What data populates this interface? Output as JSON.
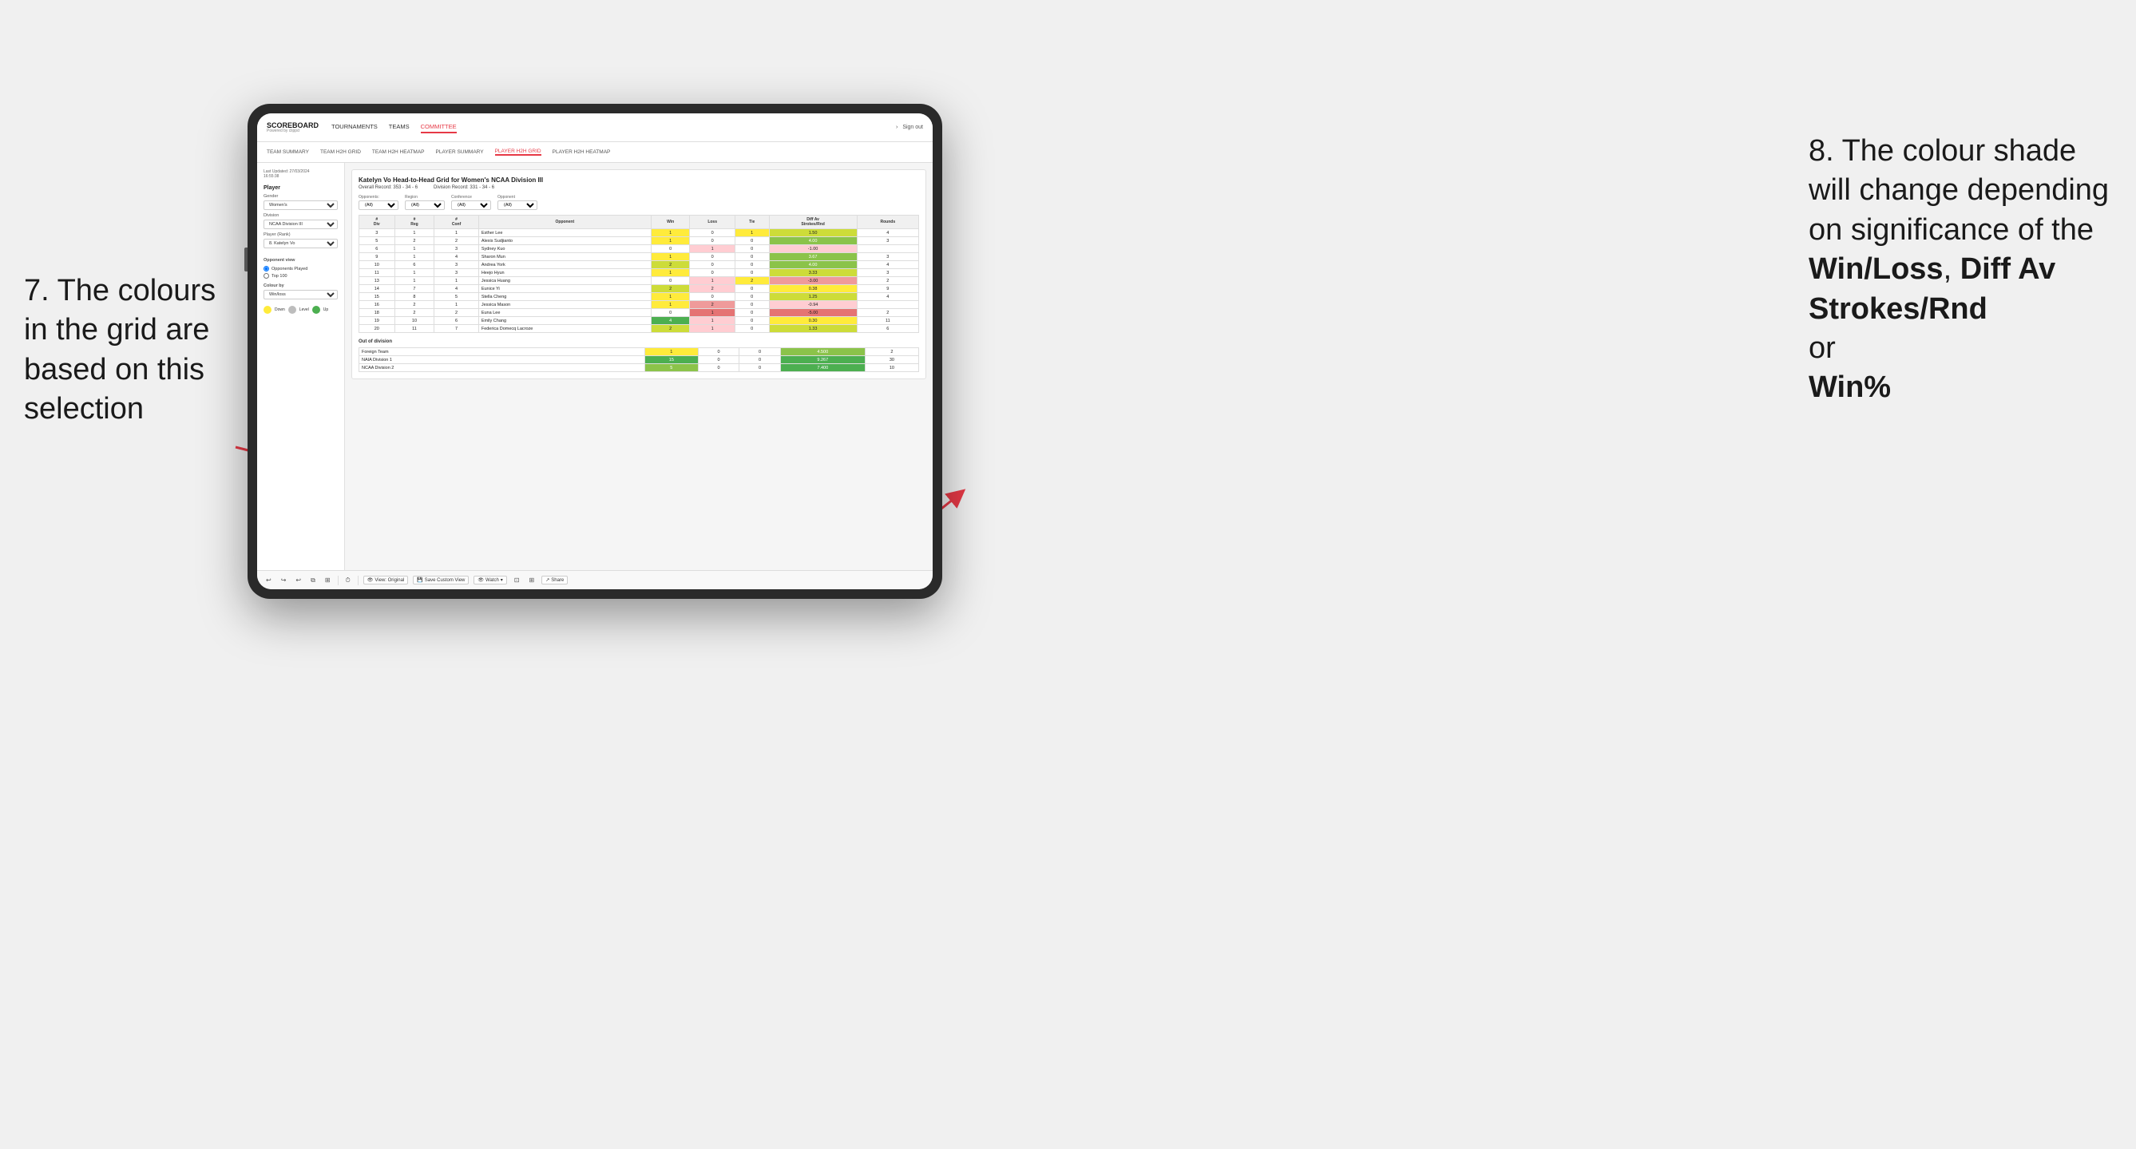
{
  "annotations": {
    "left_title": "7. The colours in the grid are based on this selection",
    "right_title": "8. The colour shade will change depending on significance of the",
    "right_bold1": "Win/Loss",
    "right_bold2": "Diff Av Strokes/Rnd",
    "right_bold3": "Win%"
  },
  "nav": {
    "logo": "SCOREBOARD",
    "logo_sub": "Powered by clippd",
    "items": [
      "TOURNAMENTS",
      "TEAMS",
      "COMMITTEE"
    ],
    "active": "COMMITTEE",
    "sign_out": "Sign out"
  },
  "sub_nav": {
    "items": [
      "TEAM SUMMARY",
      "TEAM H2H GRID",
      "TEAM H2H HEATMAP",
      "PLAYER SUMMARY",
      "PLAYER H2H GRID",
      "PLAYER H2H HEATMAP"
    ],
    "active": "PLAYER H2H GRID"
  },
  "left_panel": {
    "timestamp_label": "Last Updated: 27/03/2024",
    "timestamp_time": "16:55:38",
    "player_label": "Player",
    "gender_label": "Gender",
    "gender_value": "Women's",
    "division_label": "Division",
    "division_value": "NCAA Division III",
    "player_rank_label": "Player (Rank)",
    "player_rank_value": "8. Katelyn Vo",
    "opponent_view_label": "Opponent view",
    "opponent_played": "Opponents Played",
    "top_100": "Top 100",
    "colour_by_label": "Colour by",
    "colour_by_value": "Win/loss",
    "legend_down": "Down",
    "legend_level": "Level",
    "legend_up": "Up"
  },
  "grid": {
    "title": "Katelyn Vo Head-to-Head Grid for Women's NCAA Division III",
    "overall_label": "Overall Record:",
    "overall_value": "353 - 34 - 6",
    "division_label": "Division Record:",
    "division_value": "331 - 34 - 6",
    "filters": {
      "opponents_label": "Opponents:",
      "opponents_value": "(All)",
      "region_label": "Region",
      "region_value": "(All)",
      "conference_label": "Conference",
      "conference_value": "(All)",
      "opponent_label": "Opponent",
      "opponent_value": "(All)"
    },
    "table_headers": [
      "#\nDiv",
      "#\nReg",
      "#\nConf",
      "Opponent",
      "Win",
      "Loss",
      "Tie",
      "Diff Av\nStrokes/Rnd",
      "Rounds"
    ],
    "rows": [
      {
        "div": 3,
        "reg": 1,
        "conf": 1,
        "opponent": "Esther Lee",
        "win": 1,
        "loss": 0,
        "tie": 1,
        "diff": 1.5,
        "rounds": 4,
        "win_color": "yellow",
        "loss_color": "",
        "tie_color": "yellow",
        "diff_color": "green_light"
      },
      {
        "div": 5,
        "reg": 2,
        "conf": 2,
        "opponent": "Alexis Sudjianto",
        "win": 1,
        "loss": 0,
        "tie": 0,
        "diff": 4.0,
        "rounds": 3,
        "win_color": "yellow",
        "diff_color": "green_med"
      },
      {
        "div": 6,
        "reg": 1,
        "conf": 3,
        "opponent": "Sydney Kuo",
        "win": 0,
        "loss": 1,
        "tie": 0,
        "diff": -1.0,
        "rounds": "",
        "win_color": "",
        "loss_color": "red_light",
        "diff_color": "red_light"
      },
      {
        "div": 9,
        "reg": 1,
        "conf": 4,
        "opponent": "Sharon Mun",
        "win": 1,
        "loss": 0,
        "tie": 0,
        "diff": 3.67,
        "rounds": 3,
        "win_color": "yellow",
        "diff_color": "green_med"
      },
      {
        "div": 10,
        "reg": 6,
        "conf": 3,
        "opponent": "Andrea York",
        "win": 2,
        "loss": 0,
        "tie": 0,
        "diff": 4.0,
        "rounds": 4,
        "win_color": "green_light",
        "diff_color": "green_med"
      },
      {
        "div": 11,
        "reg": 1,
        "conf": 3,
        "opponent": "Heejo Hyun",
        "win": 1,
        "loss": 0,
        "tie": 0,
        "diff": 3.33,
        "rounds": 3,
        "win_color": "yellow",
        "diff_color": "green_light"
      },
      {
        "div": 13,
        "reg": 1,
        "conf": 1,
        "opponent": "Jessica Huang",
        "win": 0,
        "loss": 1,
        "tie": 2,
        "diff": -3.0,
        "rounds": 2,
        "win_color": "",
        "loss_color": "red_light",
        "tie_color": "yellow",
        "diff_color": "red_med"
      },
      {
        "div": 14,
        "reg": 7,
        "conf": 4,
        "opponent": "Eunice Yi",
        "win": 2,
        "loss": 2,
        "tie": 0,
        "diff": 0.38,
        "rounds": 9,
        "win_color": "green_light",
        "loss_color": "red_light",
        "diff_color": "yellow"
      },
      {
        "div": 15,
        "reg": 8,
        "conf": 5,
        "opponent": "Stella Cheng",
        "win": 1,
        "loss": 0,
        "tie": 0,
        "diff": 1.25,
        "rounds": 4,
        "win_color": "yellow",
        "diff_color": "green_light"
      },
      {
        "div": 16,
        "reg": 2,
        "conf": 1,
        "opponent": "Jessica Mason",
        "win": 1,
        "loss": 2,
        "tie": 0,
        "diff": -0.94,
        "rounds": "",
        "win_color": "yellow",
        "loss_color": "red_med",
        "diff_color": "red_light"
      },
      {
        "div": 18,
        "reg": 2,
        "conf": 2,
        "opponent": "Euna Lee",
        "win": 0,
        "loss": 1,
        "tie": 0,
        "diff": -5.0,
        "rounds": 2,
        "loss_color": "red_dark",
        "diff_color": "red_dark"
      },
      {
        "div": 19,
        "reg": 10,
        "conf": 6,
        "opponent": "Emily Chang",
        "win": 4,
        "loss": 1,
        "tie": 0,
        "diff": 0.3,
        "rounds": 11,
        "win_color": "green_dark",
        "loss_color": "red_light",
        "diff_color": "yellow"
      },
      {
        "div": 20,
        "reg": 11,
        "conf": 7,
        "opponent": "Federica Domecq Lacroze",
        "win": 2,
        "loss": 1,
        "tie": 0,
        "diff": 1.33,
        "rounds": 6,
        "win_color": "green_light",
        "loss_color": "red_light",
        "diff_color": "green_light"
      }
    ],
    "out_of_division_label": "Out of division",
    "out_of_division_rows": [
      {
        "opponent": "Foreign Team",
        "win": 1,
        "loss": 0,
        "tie": 0,
        "diff": 4.5,
        "rounds": 2,
        "win_color": "yellow",
        "diff_color": "green_med"
      },
      {
        "opponent": "NAIA Division 1",
        "win": 15,
        "loss": 0,
        "tie": 0,
        "diff": 9.267,
        "rounds": 30,
        "win_color": "green_dark",
        "diff_color": "green_dark"
      },
      {
        "opponent": "NCAA Division 2",
        "win": 5,
        "loss": 0,
        "tie": 0,
        "diff": 7.4,
        "rounds": 10,
        "win_color": "green_med",
        "diff_color": "green_dark"
      }
    ]
  },
  "toolbar": {
    "view_original": "View: Original",
    "save_custom": "Save Custom View",
    "watch": "Watch",
    "share": "Share"
  }
}
